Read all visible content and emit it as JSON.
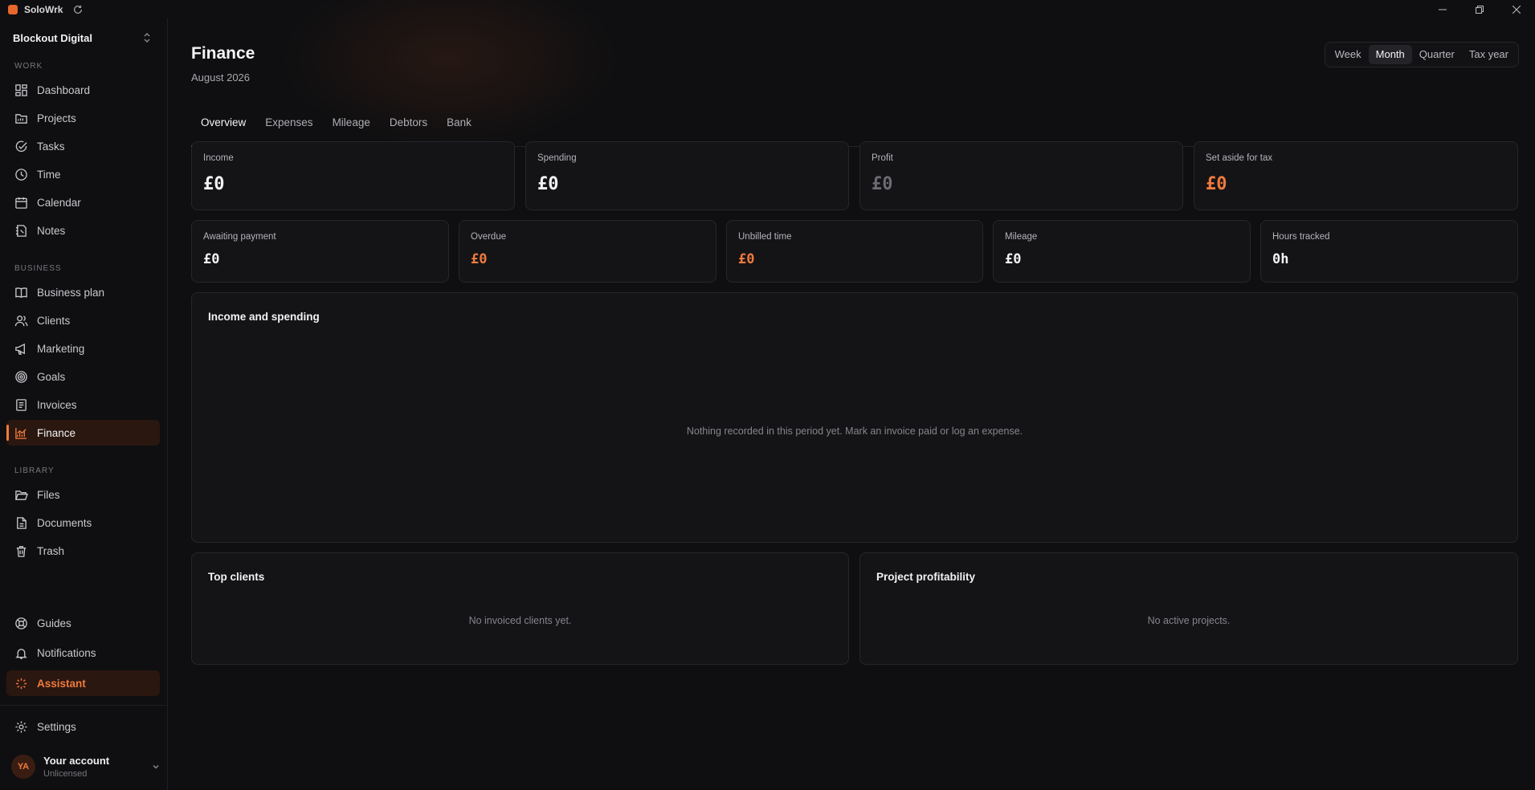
{
  "app": {
    "name": "SoloWrk"
  },
  "workspace": {
    "name": "Blockout Digital"
  },
  "sidebar": {
    "sections": {
      "work": "WORK",
      "business": "BUSINESS",
      "library": "LIBRARY"
    },
    "work_items": [
      {
        "label": "Dashboard",
        "icon": "dashboard-icon"
      },
      {
        "label": "Projects",
        "icon": "folder-icon"
      },
      {
        "label": "Tasks",
        "icon": "check-circle-icon"
      },
      {
        "label": "Time",
        "icon": "clock-icon"
      },
      {
        "label": "Calendar",
        "icon": "calendar-icon"
      },
      {
        "label": "Notes",
        "icon": "notebook-icon"
      }
    ],
    "business_items": [
      {
        "label": "Business plan",
        "icon": "book-icon"
      },
      {
        "label": "Clients",
        "icon": "users-icon"
      },
      {
        "label": "Marketing",
        "icon": "megaphone-icon"
      },
      {
        "label": "Goals",
        "icon": "target-icon"
      },
      {
        "label": "Invoices",
        "icon": "invoice-icon"
      },
      {
        "label": "Finance",
        "icon": "chart-icon",
        "active": true
      }
    ],
    "library_items": [
      {
        "label": "Files",
        "icon": "folder-open-icon"
      },
      {
        "label": "Documents",
        "icon": "document-icon"
      },
      {
        "label": "Trash",
        "icon": "trash-icon"
      }
    ],
    "bottom_items": [
      {
        "label": "Guides",
        "icon": "lifebuoy-icon"
      },
      {
        "label": "Notifications",
        "icon": "bell-icon"
      },
      {
        "label": "Assistant",
        "icon": "sparkle-icon"
      }
    ],
    "settings": {
      "label": "Settings",
      "icon": "gear-icon"
    },
    "account": {
      "initials": "YA",
      "name": "Your account",
      "status": "Unlicensed"
    }
  },
  "header": {
    "title": "Finance",
    "subtitle": "August 2026",
    "periods": [
      "Week",
      "Month",
      "Quarter",
      "Tax year"
    ],
    "selected_period": "Month"
  },
  "tabs": [
    "Overview",
    "Expenses",
    "Mileage",
    "Debtors",
    "Bank"
  ],
  "selected_tab": "Overview",
  "stats_primary": [
    {
      "label": "Income",
      "value": "£0"
    },
    {
      "label": "Spending",
      "value": "£0"
    },
    {
      "label": "Profit",
      "value": "£0"
    },
    {
      "label": "Set aside for tax",
      "value": "£0"
    }
  ],
  "stats_secondary": [
    {
      "label": "Awaiting payment",
      "value": "£0"
    },
    {
      "label": "Overdue",
      "value": "£0"
    },
    {
      "label": "Unbilled time",
      "value": "£0"
    },
    {
      "label": "Mileage",
      "value": "£0"
    },
    {
      "label": "Hours tracked",
      "value": "0h"
    }
  ],
  "income_spending": {
    "title": "Income and spending",
    "empty": "Nothing recorded in this period yet. Mark an invoice paid or log an expense."
  },
  "top_clients": {
    "title": "Top clients",
    "empty": "No invoiced clients yet."
  },
  "project_profitability": {
    "title": "Project profitability",
    "empty": "No active projects."
  },
  "colors": {
    "accent": "#f07a3c",
    "background": "#0f0f11",
    "card": "#141417"
  }
}
